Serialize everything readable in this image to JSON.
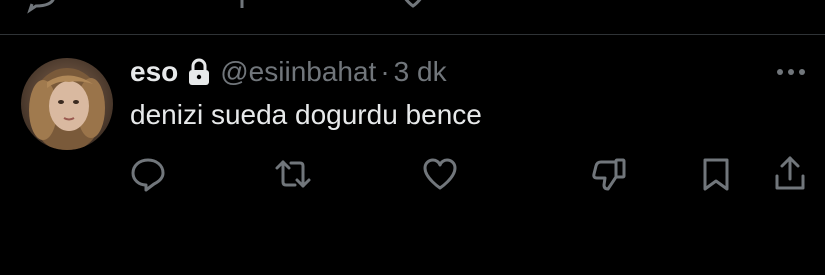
{
  "tweet": {
    "display_name": "eso",
    "handle": "@esiinbahat",
    "separator": "·",
    "time": "3 dk",
    "text": "denizi sueda dogurdu bence",
    "protected": true
  },
  "icons": {
    "lock": "lock-icon",
    "more": "more-horizontal-icon",
    "reply": "reply-icon",
    "retweet": "retweet-icon",
    "like": "heart-icon",
    "dislike": "thumbs-down-icon",
    "bookmark": "bookmark-icon",
    "share": "share-icon"
  },
  "colors": {
    "background": "#000000",
    "text_primary": "#e7e9ea",
    "text_secondary": "#71767b",
    "divider": "#2f3336"
  }
}
